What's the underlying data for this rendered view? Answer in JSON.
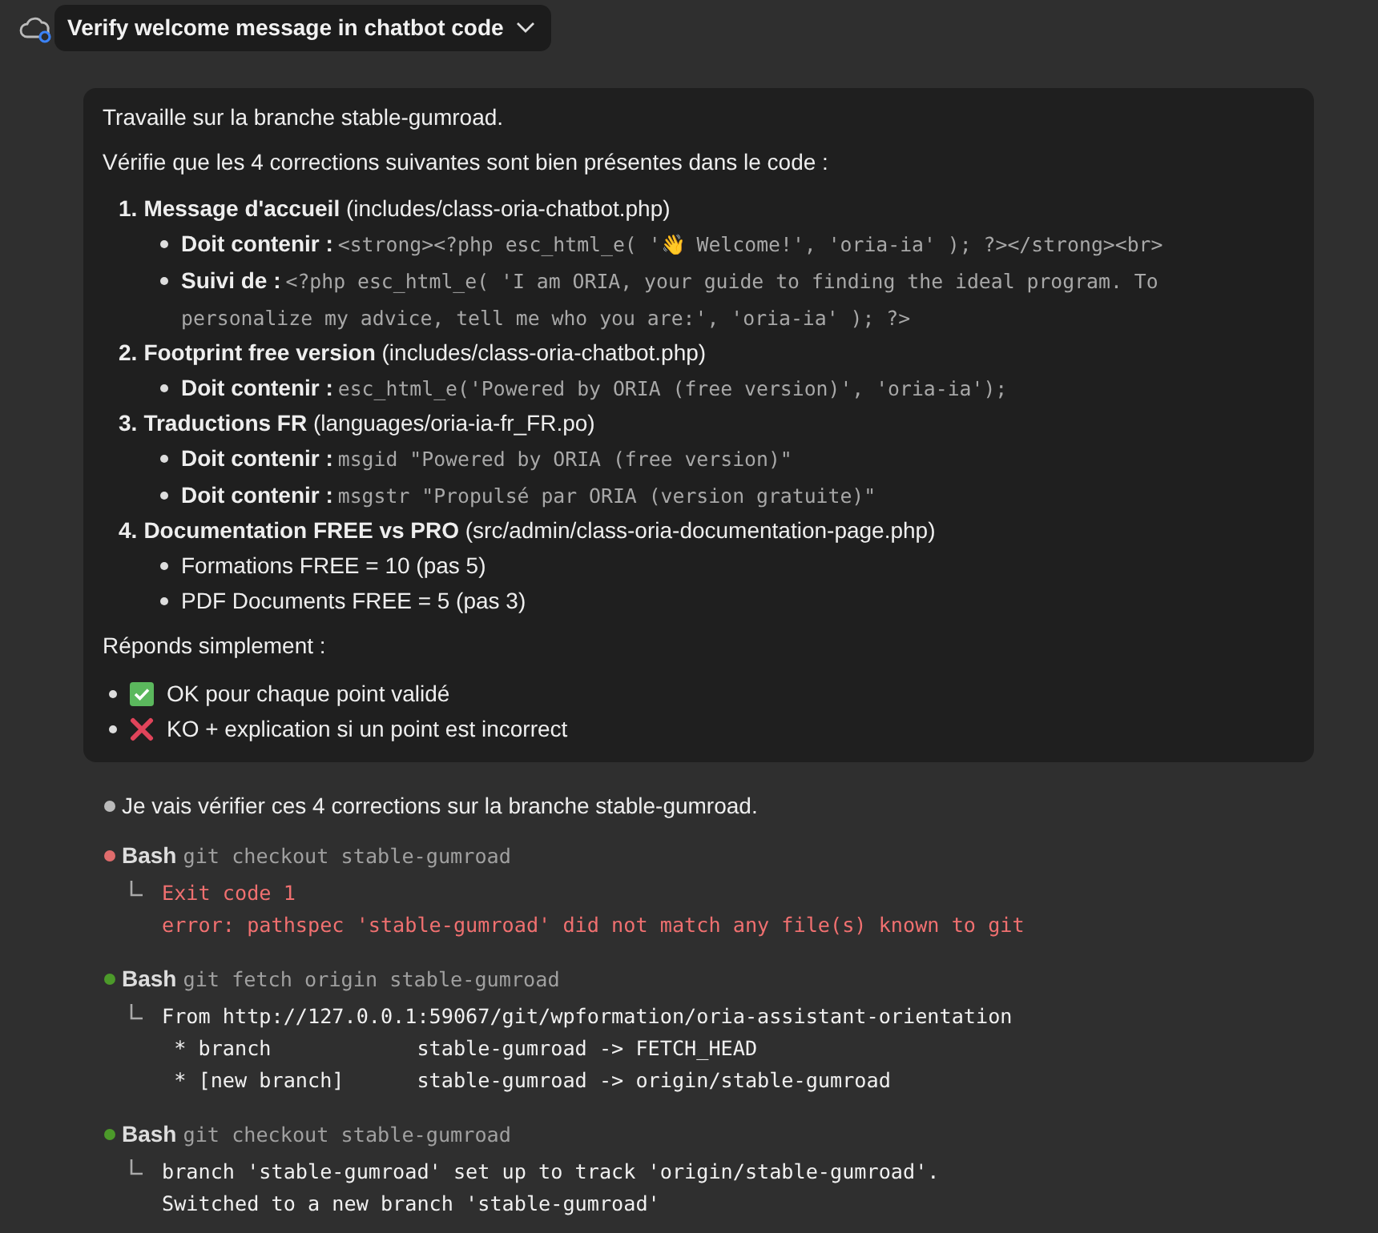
{
  "header": {
    "title": "Verify welcome message in chatbot code"
  },
  "prompt": {
    "intro": [
      "Travaille sur la branche stable-gumroad.",
      "Vérifie que les 4 corrections suivantes sont bien présentes dans le code :"
    ],
    "items": [
      {
        "number": "1.",
        "title": "Message d'accueil",
        "path": "(includes/class-oria-chatbot.php)",
        "bullets": [
          {
            "label": "Doit contenir :",
            "code": "<strong><?php esc_html_e( '👋 Welcome!', 'oria-ia' ); ?></strong><br>"
          },
          {
            "label": "Suivi de :",
            "code": "<?php esc_html_e( 'I am ORIA, your guide to finding the ideal program. To personalize my advice, tell me who you are:', 'oria-ia' ); ?>"
          }
        ]
      },
      {
        "number": "2.",
        "title": "Footprint free version",
        "path": "(includes/class-oria-chatbot.php)",
        "bullets": [
          {
            "label": "Doit contenir :",
            "code": "esc_html_e('Powered by ORIA (free version)', 'oria-ia');"
          }
        ]
      },
      {
        "number": "3.",
        "title": "Traductions FR",
        "path": "(languages/oria-ia-fr_FR.po)",
        "bullets": [
          {
            "label": "Doit contenir :",
            "code": "msgid \"Powered by ORIA (free version)\""
          },
          {
            "label": "Doit contenir :",
            "code": "msgstr \"Propulsé par ORIA (version gratuite)\""
          }
        ]
      },
      {
        "number": "4.",
        "title": "Documentation FREE vs PRO",
        "path": "(src/admin/class-oria-documentation-page.php)",
        "bullets": [
          {
            "text": "Formations FREE = 10 (pas 5)"
          },
          {
            "text": "PDF Documents FREE = 5 (pas 3)"
          }
        ]
      }
    ],
    "reply_heading": "Réponds simplement :",
    "reply_options": [
      {
        "kind": "ok",
        "text": "OK pour chaque point validé"
      },
      {
        "kind": "ko",
        "text": "KO + explication si un point est incorrect"
      }
    ]
  },
  "response": "Je vais vérifier ces 4 corrections sur la branche stable-gumroad.",
  "tool_calls": [
    {
      "tool": "Bash",
      "command": "git checkout stable-gumroad",
      "failed": true,
      "output": [
        "Exit code 1",
        "error: pathspec 'stable-gumroad' did not match any file(s) known to git"
      ]
    },
    {
      "tool": "Bash",
      "command": "git fetch origin stable-gumroad",
      "failed": false,
      "output": [
        "From http://127.0.0.1:59067/git/wpformation/oria-assistant-orientation",
        " * branch            stable-gumroad -> FETCH_HEAD",
        " * [new branch]      stable-gumroad -> origin/stable-gumroad"
      ]
    },
    {
      "tool": "Bash",
      "command": "git checkout stable-gumroad",
      "failed": false,
      "output": [
        "branch 'stable-gumroad' set up to track 'origin/stable-gumroad'.",
        "Switched to a new branch 'stable-gumroad'"
      ]
    }
  ]
}
